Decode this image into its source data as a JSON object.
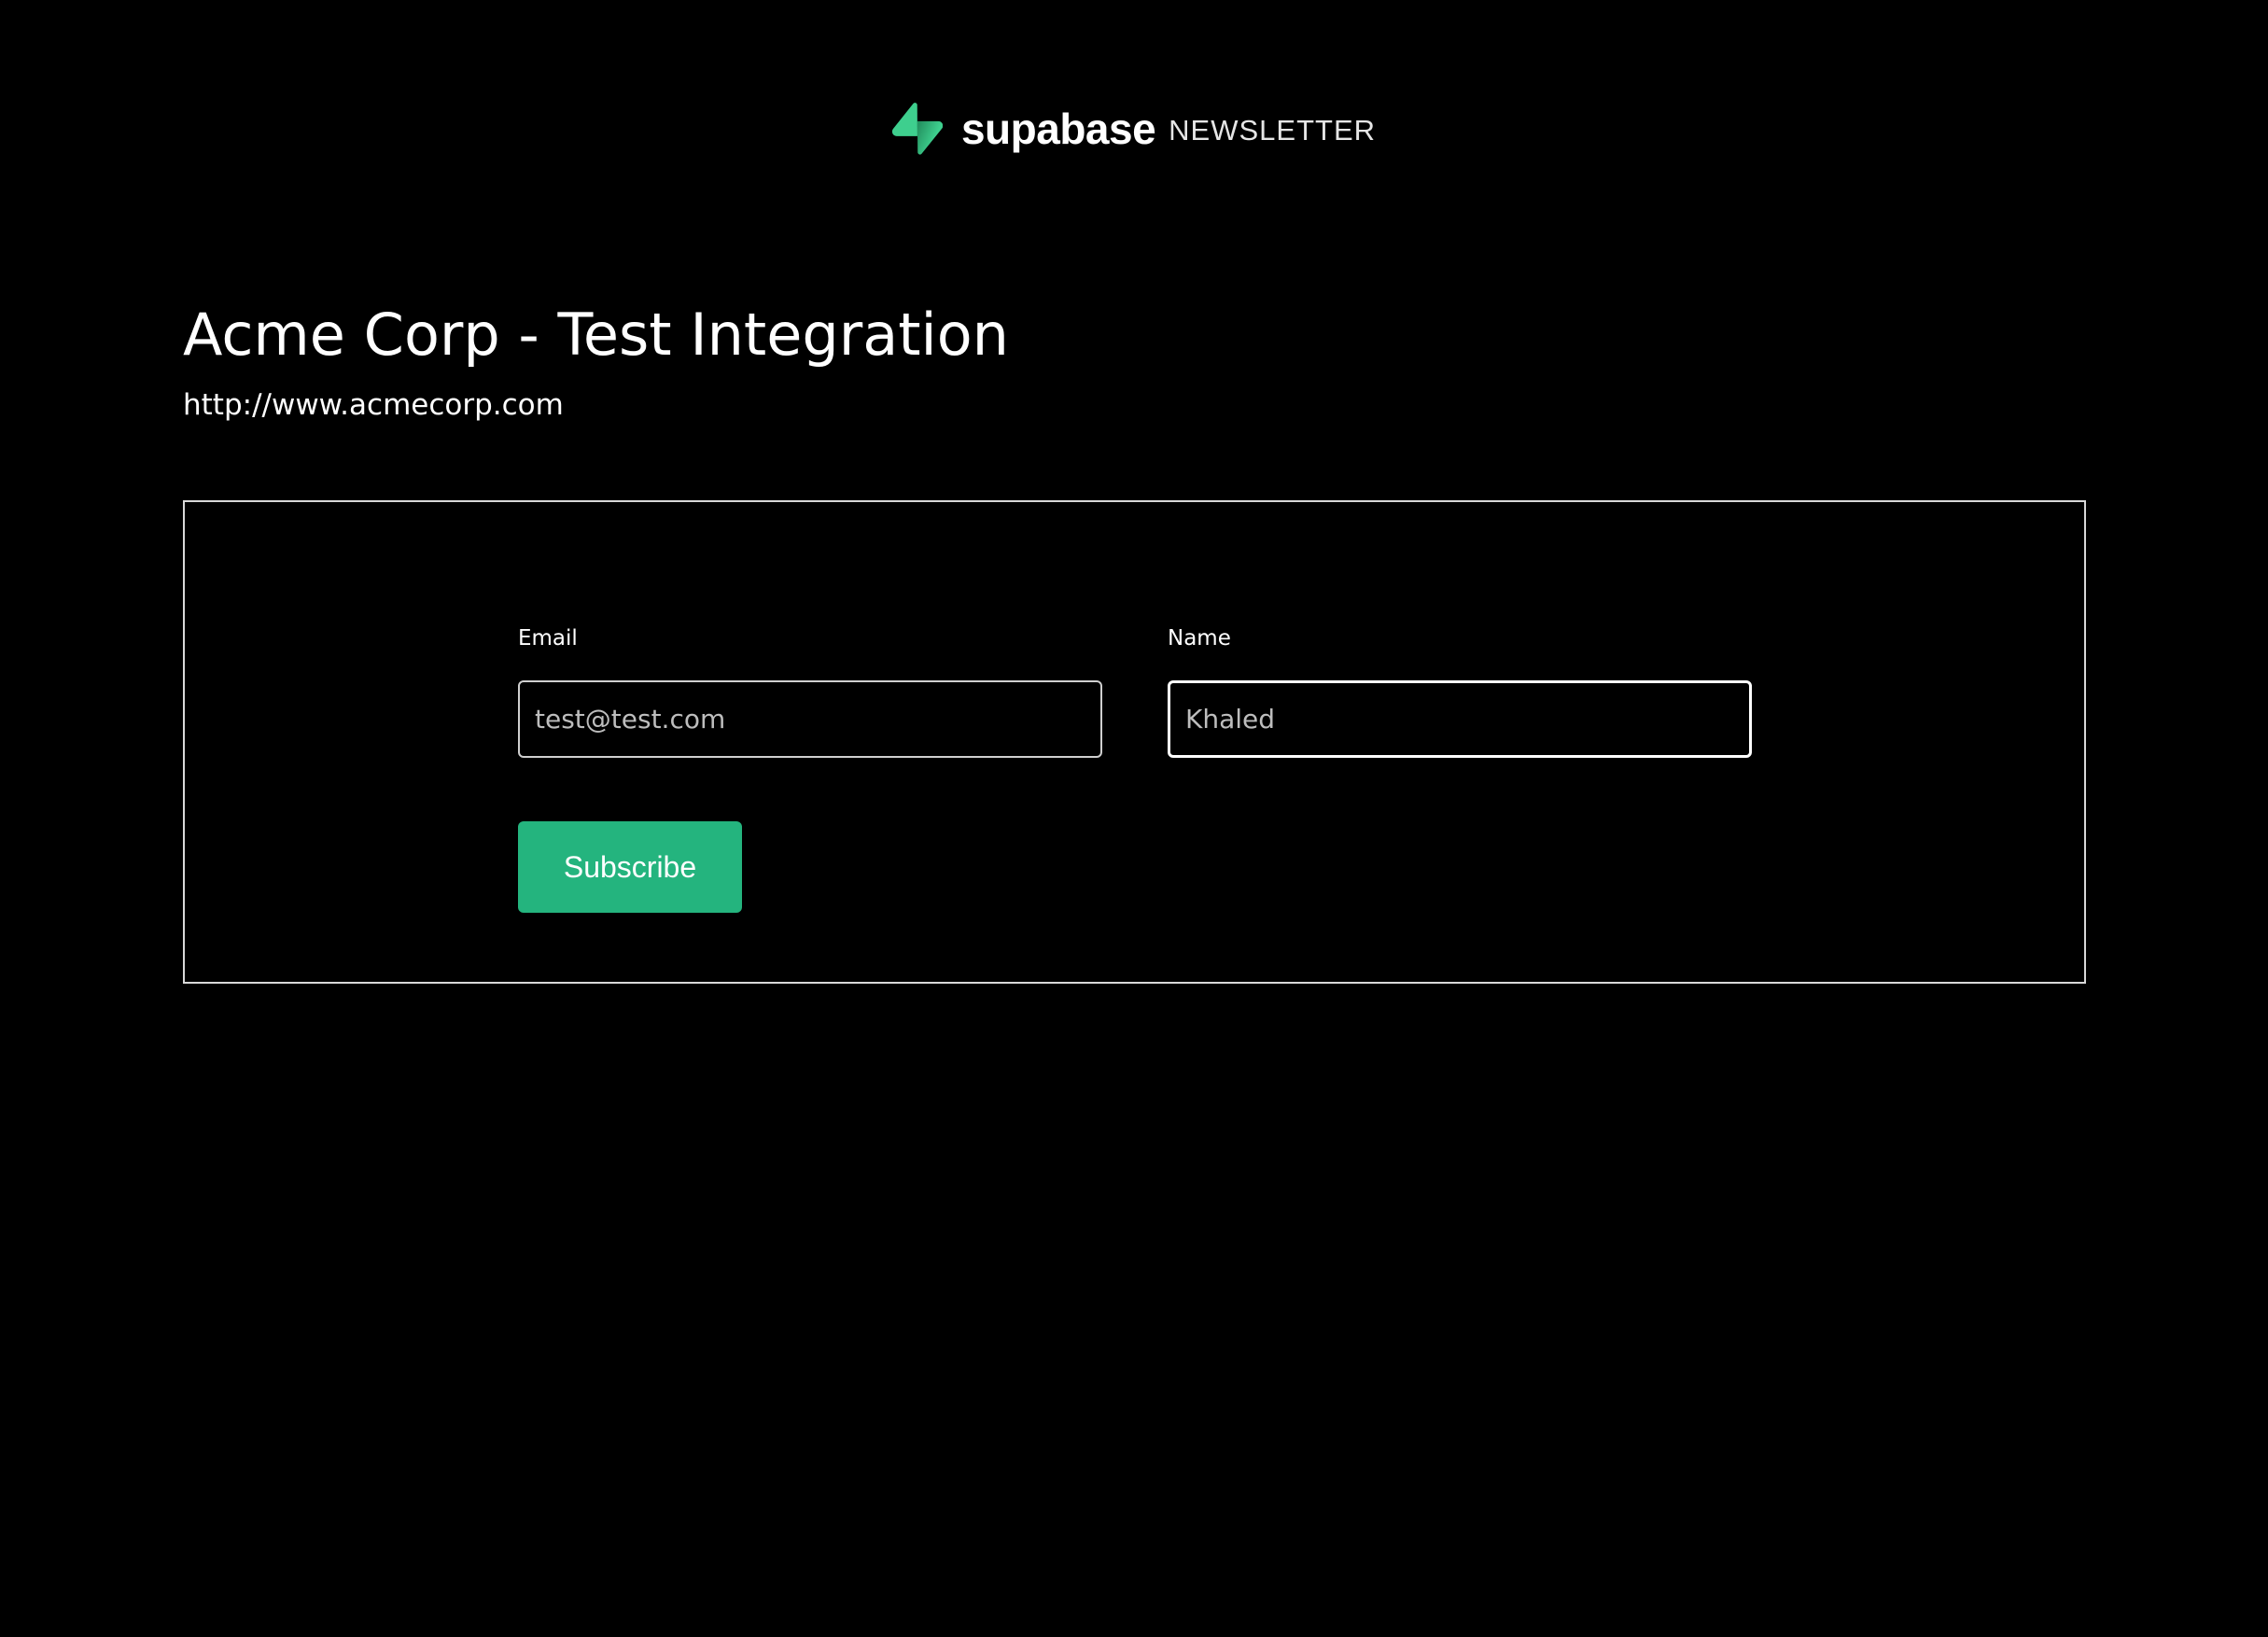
{
  "header": {
    "brand_name": "supabase",
    "brand_tag": "NEWSLETTER",
    "logo_icon": "supabase-bolt-icon",
    "accent_color": "#3ECF8E"
  },
  "main": {
    "title": "Acme Corp - Test Integration",
    "url": "http://www.acmecorp.com"
  },
  "form": {
    "email": {
      "label": "Email",
      "placeholder": "test@test.com",
      "value": ""
    },
    "name": {
      "label": "Name",
      "placeholder": "Khaled",
      "value": ""
    },
    "subscribe_label": "Subscribe",
    "button_color": "#24B47E"
  }
}
